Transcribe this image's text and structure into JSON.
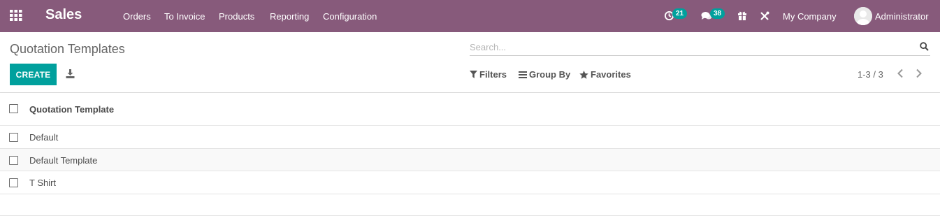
{
  "app": {
    "name": "Sales",
    "apps_icon": "grid-icon"
  },
  "menu": [
    "Orders",
    "To Invoice",
    "Products",
    "Reporting",
    "Configuration"
  ],
  "systray": {
    "activity_count": "21",
    "messages_count": "38",
    "company": "My Company",
    "user": "Administrator"
  },
  "breadcrumb": {
    "title": "Quotation Templates"
  },
  "search": {
    "placeholder": "Search..."
  },
  "buttons": {
    "create": "CREATE"
  },
  "filters": {
    "filters": "Filters",
    "group_by": "Group By",
    "favorites": "Favorites"
  },
  "pager": {
    "value": "1-3 / 3"
  },
  "list": {
    "column": "Quotation Template",
    "rows": [
      "Default",
      "Default Template",
      "T Shirt"
    ]
  },
  "colors": {
    "navbar": "#875a7b",
    "primary": "#00a09d"
  }
}
